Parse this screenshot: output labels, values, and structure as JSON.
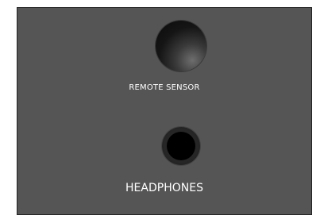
{
  "panel": {
    "remote_sensor_label": "REMOTE SENSOR",
    "headphones_label": "HEADPHONES",
    "panel_color": "#555555",
    "label_color": "#ffffff"
  },
  "icons": {
    "sensor": "remote-sensor-window",
    "jack": "headphone-jack"
  }
}
